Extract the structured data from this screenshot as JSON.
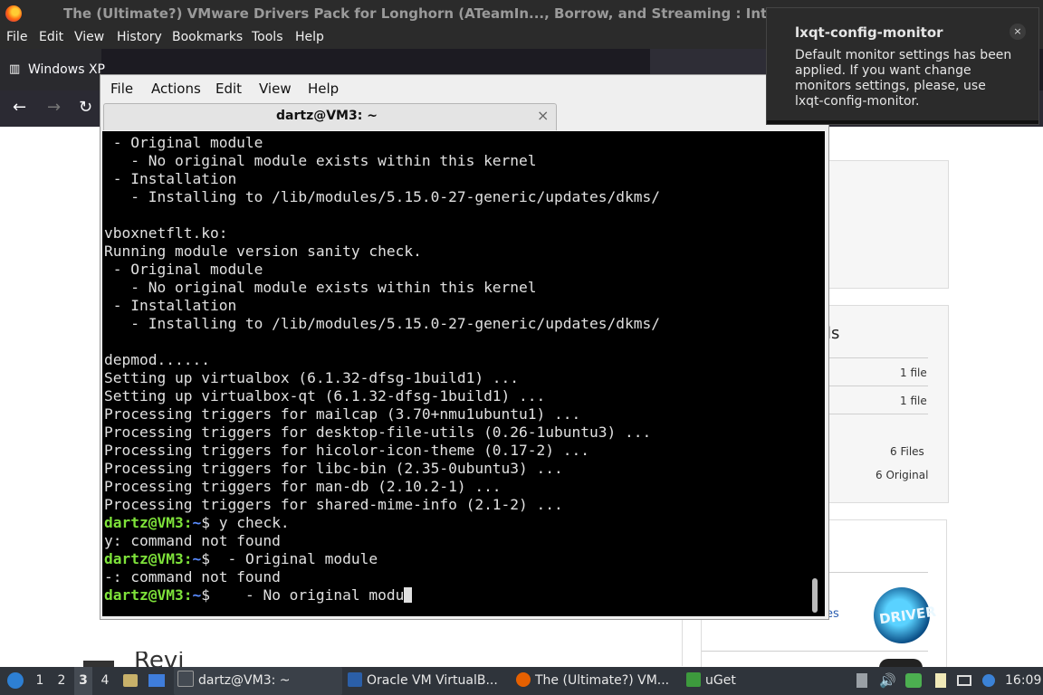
{
  "browser": {
    "title": "The (Ultimate?) VMware Drivers Pack for Longhorn (ATeamIn..., Borrow, and Streaming : Inter",
    "menu": [
      "File",
      "Edit",
      "View",
      "History",
      "Bookmarks",
      "Tools",
      "Help"
    ],
    "tab_label": "Windows XP",
    "nav": {
      "back": "←",
      "forward": "→",
      "reload": "↻"
    }
  },
  "page": {
    "panel_title_fragment": "ls",
    "rows": [
      {
        "value": "1 file"
      },
      {
        "value": "1 file"
      },
      {
        "value": "6 Files"
      },
      {
        "value": "6 Original"
      }
    ],
    "link_fragment": "es",
    "badge_text": "DRIVER",
    "heading_fragment": "Revi"
  },
  "terminal": {
    "menu": [
      "File",
      "Actions",
      "Edit",
      "View",
      "Help"
    ],
    "tab_title": "dartz@VM3: ~",
    "tab_close": "×",
    "lines": [
      " - Original module",
      "   - No original module exists within this kernel",
      " - Installation",
      "   - Installing to /lib/modules/5.15.0-27-generic/updates/dkms/",
      "",
      "vboxnetflt.ko:",
      "Running module version sanity check.",
      " - Original module",
      "   - No original module exists within this kernel",
      " - Installation",
      "   - Installing to /lib/modules/5.15.0-27-generic/updates/dkms/",
      "",
      "depmod......",
      "Setting up virtualbox (6.1.32-dfsg-1build1) ...",
      "Setting up virtualbox-qt (6.1.32-dfsg-1build1) ...",
      "Processing triggers for mailcap (3.70+nmu1ubuntu1) ...",
      "Processing triggers for desktop-file-utils (0.26-1ubuntu3) ...",
      "Processing triggers for hicolor-icon-theme (0.17-2) ...",
      "Processing triggers for libc-bin (2.35-0ubuntu3) ...",
      "Processing triggers for man-db (2.10.2-1) ...",
      "Processing triggers for shared-mime-info (2.1-2) ..."
    ],
    "prompt_user": "dartz@VM3",
    "prompt_sep": ":",
    "prompt_dir": "~",
    "prompt_end": "$",
    "session": [
      {
        "type": "prompt",
        "cmd": " y check."
      },
      {
        "type": "out",
        "text": "y: command not found"
      },
      {
        "type": "prompt",
        "cmd": "  - Original module"
      },
      {
        "type": "out",
        "text": "-: command not found"
      },
      {
        "type": "prompt",
        "cmd": "    - No original modu",
        "cursor": true
      }
    ]
  },
  "notification": {
    "title": "lxqt-config-monitor",
    "body": "Default monitor settings has been applied. If you want change monitors settings, please, use lxqt-config-monitor.",
    "close": "×"
  },
  "taskbar": {
    "workspaces": [
      "1",
      "2",
      "3",
      "4"
    ],
    "active_workspace": "3",
    "tasks": [
      {
        "label": "dartz@VM3: ~",
        "color": "#444a52"
      },
      {
        "label": "Oracle VM VirtualB...",
        "color": "#2b5fa8"
      },
      {
        "label": "The (Ultimate?) VM...",
        "color": "#e66000"
      },
      {
        "label": "uGet",
        "color": "#3d9a3d"
      }
    ],
    "clock": "16:09"
  }
}
